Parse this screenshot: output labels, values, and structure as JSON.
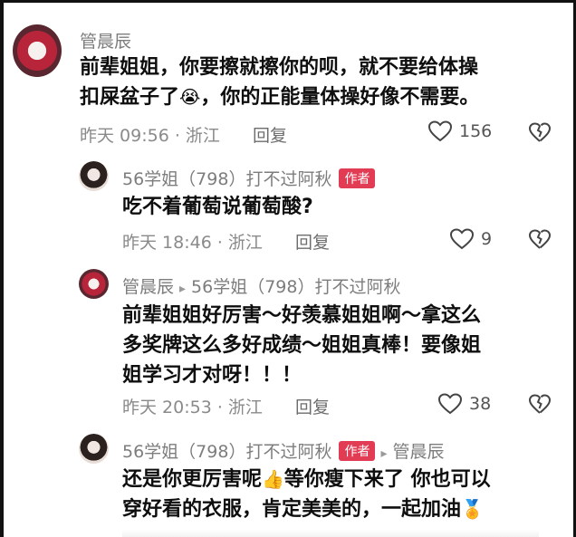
{
  "comments": [
    {
      "author": "管晨辰",
      "text": "前辈姐姐，你要擦就擦你的呗，就不要给体操扣屎盆子了😭，你的正能量体操好像不需要。",
      "line1": "前辈姐姐，你要擦就擦你的呗，就不要给体操",
      "line2a": "扣屎盆子了",
      "emoji": "😭",
      "line2b": "，你的正能量体操好像不需要。",
      "time": "昨天 09:56 · 浙江",
      "reply_label": "回复",
      "likes": "156"
    },
    {
      "author": "56学姐（798）打不过阿秋",
      "badge": "作者",
      "text": "吃不着葡萄说葡萄酸?",
      "time": "昨天 18:46 · 浙江",
      "reply_label": "回复",
      "likes": "9"
    },
    {
      "author": "管晨辰",
      "reply_to": "56学姐（798）打不过阿秋",
      "line1": "前辈姐姐好厉害～好羡慕姐姐啊～拿这么",
      "line2": "多奖牌这么多好成绩～姐姐真棒！要像姐",
      "line3": "姐学习才对呀！！！",
      "time": "昨天 20:53 · 浙江",
      "reply_label": "回复",
      "likes": "38"
    },
    {
      "author": "56学姐（798）打不过阿秋",
      "badge": "作者",
      "reply_to": "管晨辰",
      "line1a": "还是你更厉害呢",
      "emoji1": "👍",
      "line1b": "等你瘦下来了 你也可以",
      "line2a": "穿好看的衣服，肯定美美的，一起加油",
      "emoji2": "🏅"
    }
  ]
}
